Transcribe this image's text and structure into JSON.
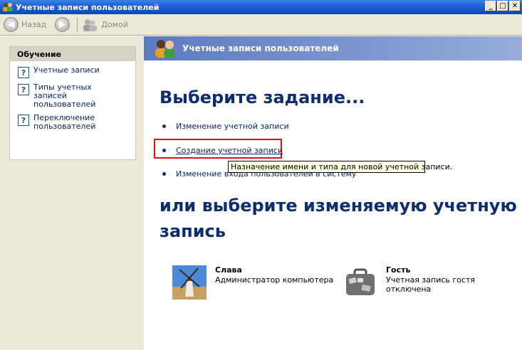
{
  "window": {
    "title": "Учетные записи пользователей",
    "minimize": "_",
    "maximize": "□",
    "close": "✕"
  },
  "toolbar": {
    "back_label": "Назад",
    "home_label": "Домой"
  },
  "sidebar": {
    "heading": "Обучение",
    "items": [
      {
        "label": "Учетные записи"
      },
      {
        "label": "Типы учетных записей пользователей"
      },
      {
        "label": "Переключение пользователей"
      }
    ]
  },
  "header": {
    "title": "Учетные записи пользователей"
  },
  "main": {
    "pick_task_heading": "Выберите задание...",
    "tasks": [
      {
        "label": "Изменение учетной записи"
      },
      {
        "label": "Создание учетной записи"
      },
      {
        "label": "Изменение входа пользователей в систему"
      }
    ],
    "tooltip": "Назначение имени и типа для новой учетной записи.",
    "pick_account_heading_line1": "или выберите изменяемую учетную",
    "pick_account_heading_line2": "запись",
    "accounts": [
      {
        "name": "Слава",
        "desc1": "Администратор компьютера",
        "desc2": ""
      },
      {
        "name": "Гость",
        "desc1": "Учетная запись гостя",
        "desc2": "отключена"
      }
    ]
  },
  "colors": {
    "title_bar": "#1f5fd4",
    "header_band": "#7e97d1",
    "heading_text": "#0d2d73",
    "highlight_border": "#e01010",
    "tooltip_bg": "#ffffe1"
  }
}
